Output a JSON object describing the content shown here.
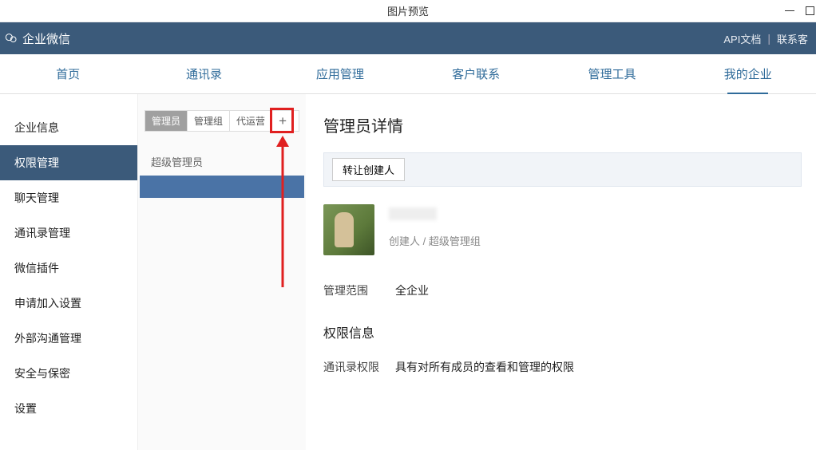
{
  "os": {
    "title": "图片预览"
  },
  "header": {
    "brand": "企业微信",
    "links": {
      "api": "API文档",
      "contact": "联系客"
    }
  },
  "nav": {
    "items": [
      "首页",
      "通讯录",
      "应用管理",
      "客户联系",
      "管理工具",
      "我的企业"
    ],
    "activeIndex": 5
  },
  "sidebar": {
    "items": [
      "企业信息",
      "权限管理",
      "聊天管理",
      "通讯录管理",
      "微信插件",
      "申请加入设置",
      "外部沟通管理",
      "安全与保密",
      "设置"
    ],
    "activeIndex": 1
  },
  "midCol": {
    "tabs": [
      "管理员",
      "管理组",
      "代运营"
    ],
    "activeTab": 0,
    "addLabel": "+",
    "groupLabel": "超级管理员"
  },
  "detail": {
    "title": "管理员详情",
    "transferBtn": "转让创建人",
    "profile": {
      "role": "创建人 / 超级管理组"
    },
    "scope": {
      "key": "管理范围",
      "val": "全企业"
    },
    "permSection": "权限信息",
    "perm": {
      "key": "通讯录权限",
      "val": "具有对所有成员的查看和管理的权限"
    }
  }
}
